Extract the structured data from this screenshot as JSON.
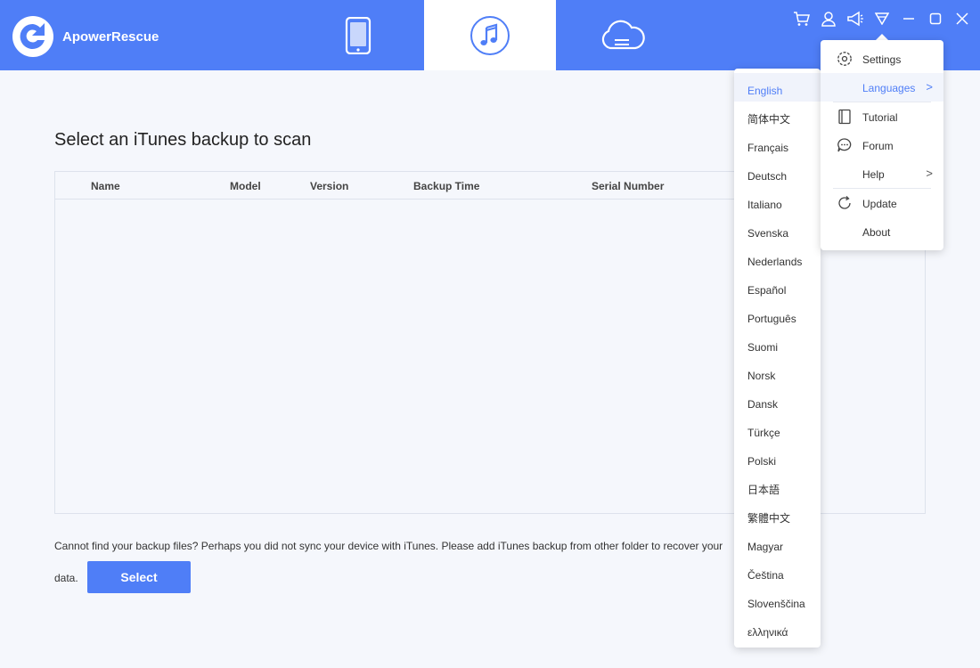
{
  "app": {
    "title": "ApowerRescue"
  },
  "tabs": [
    {
      "name": "device",
      "icon": "phone-icon"
    },
    {
      "name": "itunes",
      "icon": "music-note-icon",
      "active": true
    },
    {
      "name": "cloud",
      "icon": "cloud-icon"
    }
  ],
  "header_icons": [
    "cart-icon",
    "user-icon",
    "megaphone-icon",
    "menu-triangle-icon",
    "minimize-icon",
    "maximize-icon",
    "close-icon"
  ],
  "main": {
    "title": "Select an iTunes backup to scan",
    "columns": [
      "Name",
      "Model",
      "Version",
      "Backup Time",
      "Serial Number"
    ],
    "rows": [],
    "info_line1": "Cannot find your backup files? Perhaps you did not sync your device with iTunes. Please add iTunes backup from other folder to recover your",
    "info_line2": "data.",
    "select_label": "Select"
  },
  "menu": {
    "settings": "Settings",
    "languages": "Languages",
    "tutorial": "Tutorial",
    "forum": "Forum",
    "help": "Help",
    "update": "Update",
    "about": "About"
  },
  "languages": {
    "selected": "English",
    "items": [
      "English",
      "简体中文",
      "Français",
      "Deutsch",
      "Italiano",
      "Svenska",
      "Nederlands",
      "Español",
      "Português",
      "Suomi",
      "Norsk",
      "Dansk",
      "Türkçe",
      "Polski",
      "日本語",
      "繁體中文",
      "Magyar",
      "Čeština",
      "Slovenščina",
      "ελληνικά"
    ]
  },
  "colors": {
    "accent": "#4f7ef7",
    "background": "#f5f7fc"
  }
}
